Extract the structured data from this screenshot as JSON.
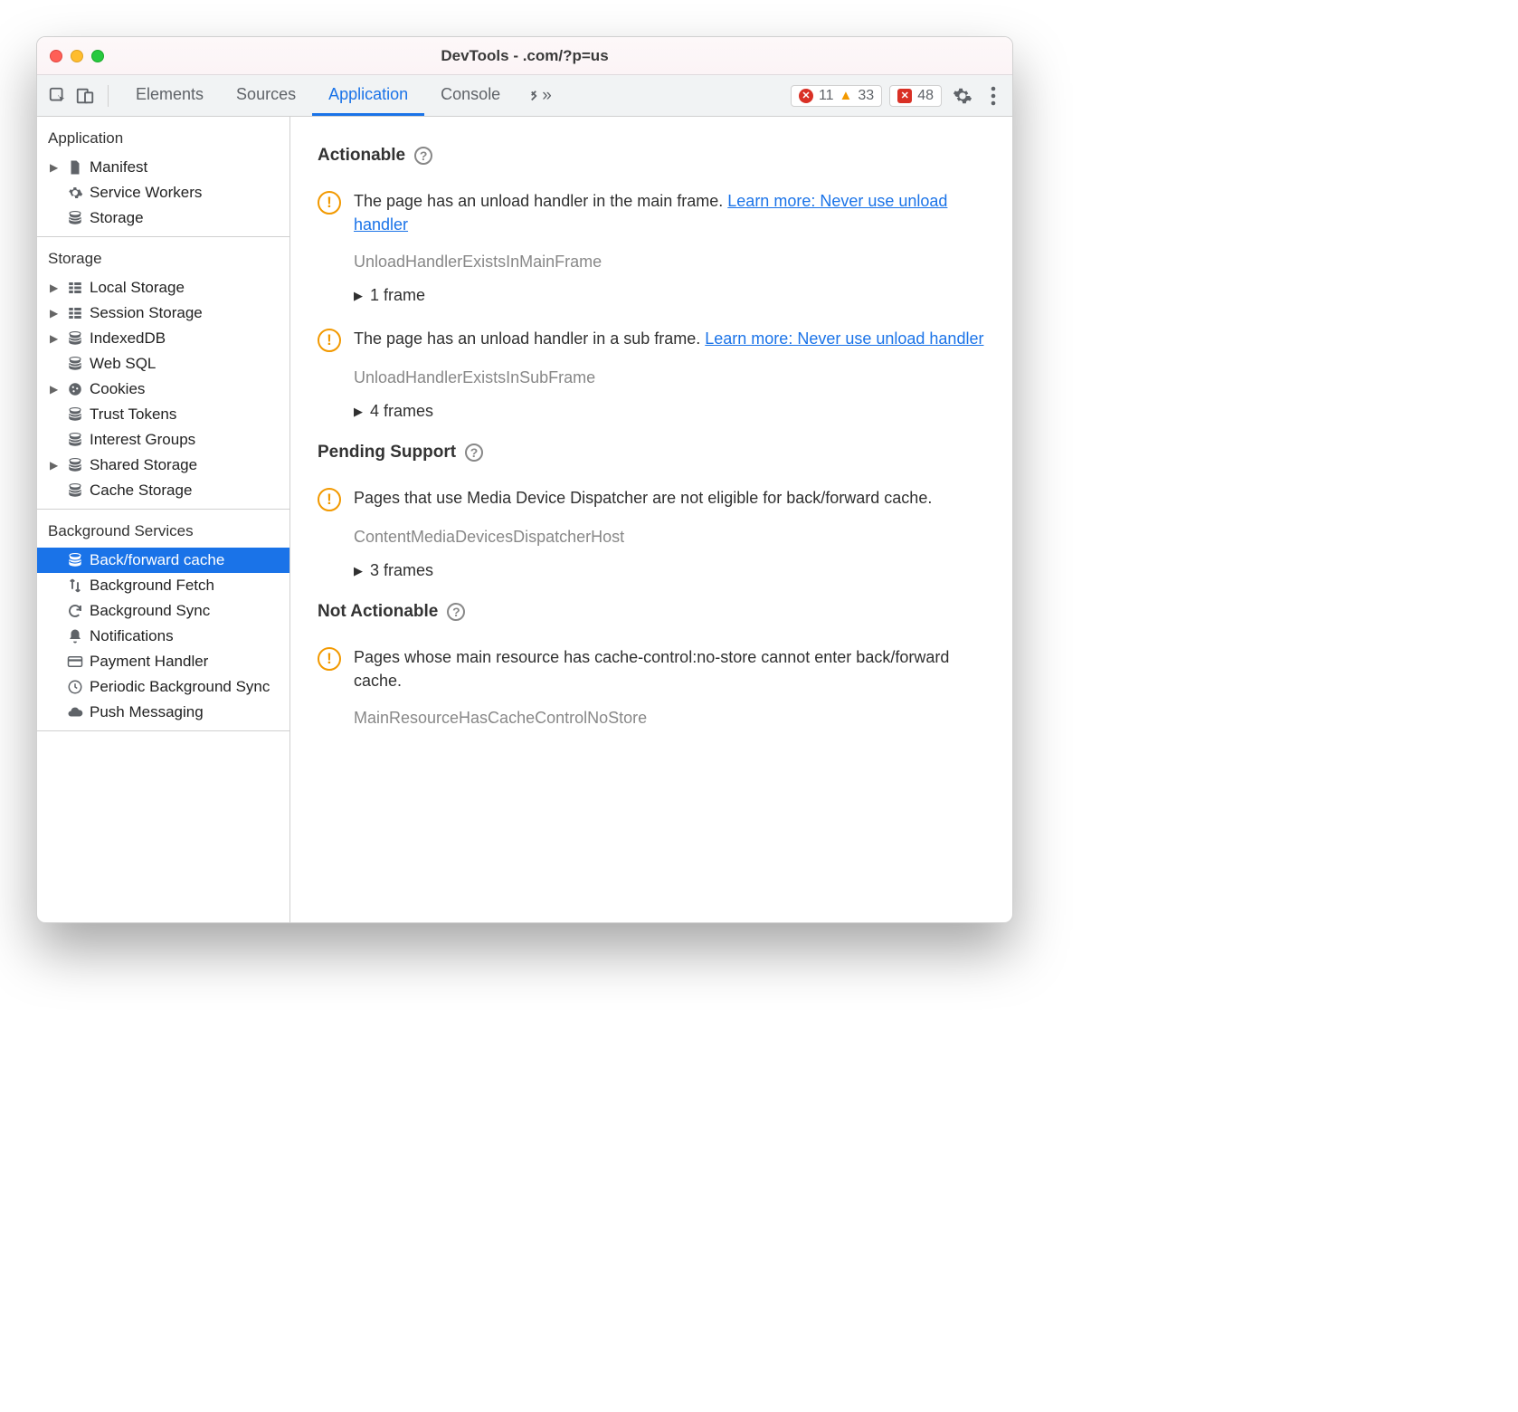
{
  "window": {
    "title": "DevTools -            .com/?p=us"
  },
  "toolbar": {
    "tabs": [
      "Elements",
      "Sources",
      "Application",
      "Console"
    ],
    "active_tab": "Application",
    "errors": "11",
    "warnings": "33",
    "issues": "48"
  },
  "sidebar": {
    "groups": [
      {
        "head": "Application",
        "items": [
          {
            "label": "Manifest",
            "icon": "file",
            "expandable": true
          },
          {
            "label": "Service Workers",
            "icon": "gear"
          },
          {
            "label": "Storage",
            "icon": "db"
          }
        ]
      },
      {
        "head": "Storage",
        "items": [
          {
            "label": "Local Storage",
            "icon": "grid",
            "expandable": true
          },
          {
            "label": "Session Storage",
            "icon": "grid",
            "expandable": true
          },
          {
            "label": "IndexedDB",
            "icon": "db",
            "expandable": true
          },
          {
            "label": "Web SQL",
            "icon": "db"
          },
          {
            "label": "Cookies",
            "icon": "cookie",
            "expandable": true
          },
          {
            "label": "Trust Tokens",
            "icon": "db"
          },
          {
            "label": "Interest Groups",
            "icon": "db"
          },
          {
            "label": "Shared Storage",
            "icon": "db",
            "expandable": true
          },
          {
            "label": "Cache Storage",
            "icon": "db"
          }
        ]
      },
      {
        "head": "Background Services",
        "items": [
          {
            "label": "Back/forward cache",
            "icon": "db",
            "selected": true
          },
          {
            "label": "Background Fetch",
            "icon": "updown"
          },
          {
            "label": "Background Sync",
            "icon": "sync"
          },
          {
            "label": "Notifications",
            "icon": "bell"
          },
          {
            "label": "Payment Handler",
            "icon": "card"
          },
          {
            "label": "Periodic Background Sync",
            "icon": "clock"
          },
          {
            "label": "Push Messaging",
            "icon": "cloud"
          }
        ]
      }
    ]
  },
  "content": {
    "sections": [
      {
        "title": "Actionable",
        "issues": [
          {
            "text": "The page has an unload handler in the main frame. ",
            "link": "Learn more: Never use unload handler",
            "code": "UnloadHandlerExistsInMainFrame",
            "expand": "1 frame"
          },
          {
            "text": "The page has an unload handler in a sub frame. ",
            "link": "Learn more: Never use unload handler",
            "code": "UnloadHandlerExistsInSubFrame",
            "expand": "4 frames"
          }
        ]
      },
      {
        "title": "Pending Support",
        "issues": [
          {
            "text": "Pages that use Media Device Dispatcher are not eligible for back/forward cache.",
            "code": "ContentMediaDevicesDispatcherHost",
            "expand": "3 frames"
          }
        ]
      },
      {
        "title": "Not Actionable",
        "issues": [
          {
            "text": "Pages whose main resource has cache-control:no-store cannot enter back/forward cache.",
            "code": "MainResourceHasCacheControlNoStore"
          }
        ]
      }
    ]
  }
}
